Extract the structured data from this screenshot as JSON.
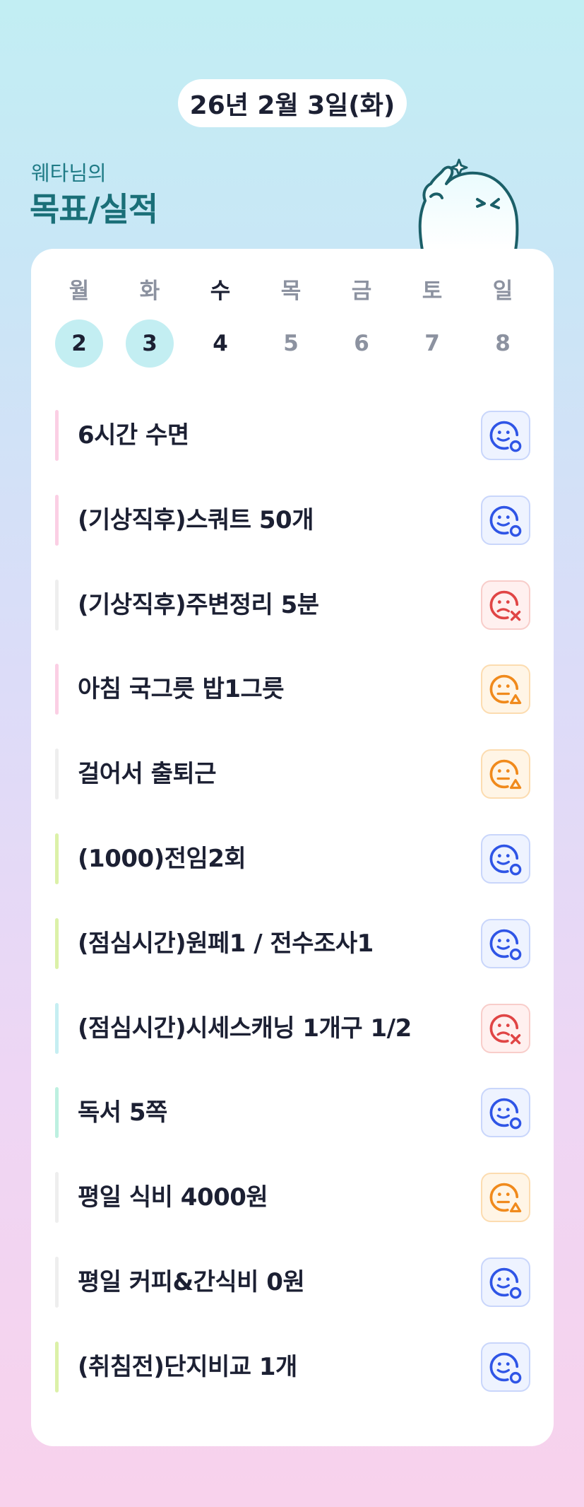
{
  "header": {
    "date": "26년 2월 3일(화)",
    "subtitle": "웨타님의",
    "title": "목표/실적"
  },
  "week": [
    {
      "name": "월",
      "num": "2",
      "state": "done"
    },
    {
      "name": "화",
      "num": "3",
      "state": "done"
    },
    {
      "name": "수",
      "num": "4",
      "state": "today"
    },
    {
      "name": "목",
      "num": "5",
      "state": "future"
    },
    {
      "name": "금",
      "num": "6",
      "state": "future"
    },
    {
      "name": "토",
      "num": "7",
      "state": "future"
    },
    {
      "name": "일",
      "num": "8",
      "state": "future"
    }
  ],
  "goals": [
    {
      "text": "6시간 수면",
      "bar_color": "#fbcfe4",
      "status": "success"
    },
    {
      "text": "(기상직후)스쿼트 50개",
      "bar_color": "#fbcfe4",
      "status": "success"
    },
    {
      "text": "(기상직후)주변정리 5분",
      "bar_color": "#eeeeee",
      "status": "fail"
    },
    {
      "text": "아침 국그릇 밥1그릇",
      "bar_color": "#fbcfe4",
      "status": "partial"
    },
    {
      "text": "걸어서 출퇴근",
      "bar_color": "#eeeeee",
      "status": "partial"
    },
    {
      "text": "(1000)전임2회",
      "bar_color": "#dcf1a8",
      "status": "success"
    },
    {
      "text": "(점심시간)원페1 / 전수조사1",
      "bar_color": "#dcf1a8",
      "status": "success"
    },
    {
      "text": "(점심시간)시세스캐닝 1개구 1/2",
      "bar_color": "#c6eef2",
      "status": "fail"
    },
    {
      "text": "독서 5쪽",
      "bar_color": "#bdf0e0",
      "status": "success"
    },
    {
      "text": "평일 식비 4000원",
      "bar_color": "#eeeeee",
      "status": "partial"
    },
    {
      "text": "평일 커피&간식비 0원",
      "bar_color": "#eeeeee",
      "status": "success"
    },
    {
      "text": "(취침전)단지비교 1개",
      "bar_color": "#dcf1a8",
      "status": "success"
    }
  ],
  "status_styles": {
    "success": {
      "icon": "smile-circle-icon",
      "color": "#2f55e6",
      "bg": "#eef3ff",
      "border": "#c9d6fb"
    },
    "fail": {
      "icon": "sad-x-icon",
      "color": "#e04545",
      "bg": "#fff0ef",
      "border": "#f8cdca"
    },
    "partial": {
      "icon": "meh-triangle-icon",
      "color": "#f08a1c",
      "bg": "#fff5e6",
      "border": "#fcdcb0"
    }
  }
}
